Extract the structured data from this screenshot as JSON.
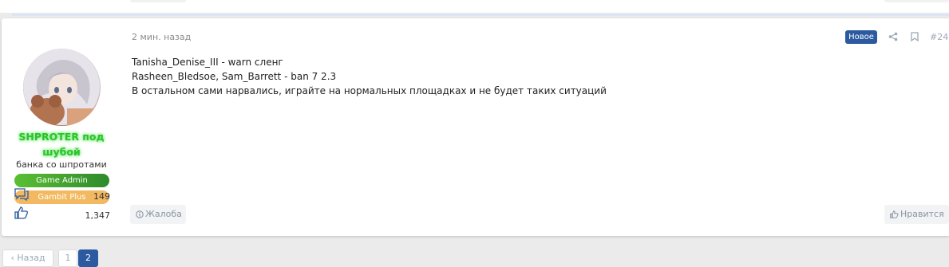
{
  "post": {
    "user": {
      "name": "SHPROTER под шубой",
      "title": "банка со шпротами",
      "banners": [
        "Game Admin",
        "Gambit Plus"
      ],
      "messages_count": "149",
      "reactions_count": "1,347",
      "avatar_icon": "avatar-anime-character"
    },
    "date": "2 мин. назад",
    "badge": "Новое",
    "number": "#24",
    "body": [
      "Tanisha_Denise_III - warn сленг",
      "Rasheen_Bledsoe, Sam_Barrett - ban 7 2.3",
      "В остальном сами нарвались, играйте на нормальных площадках и не будет таких ситуаций"
    ],
    "report_label": "Жалоба",
    "like_label": "Нравится"
  },
  "pagination": {
    "prev_label": "Назад",
    "pages": [
      "1",
      "2"
    ],
    "current": "2"
  },
  "colors": {
    "username": "#2ec02e",
    "accent": "#2b5aa0",
    "banner_admin": "#3aa030",
    "banner_plus": "#f2b960"
  }
}
